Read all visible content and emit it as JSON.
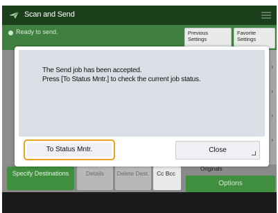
{
  "header": {
    "title": "Scan and Send",
    "icon": "send-arrow-icon",
    "menu_icon": "menu-icon"
  },
  "status": {
    "text": "Ready to send.",
    "previous_settings": "Previous Settings",
    "favorite_settings": "Favorite Settings"
  },
  "background": {
    "specify_destinations": "Specify Destinations",
    "details": "Details",
    "delete_dest": "Delete Dest.",
    "cc_bcc": "Cc Bcc",
    "originals": "Originals",
    "options": "Options"
  },
  "dialog": {
    "message_line1": "The Send job has been accepted.",
    "message_line2": "Press [To Status Mntr.] to check the current job status.",
    "status_button": "To Status Mntr.",
    "close_button": "Close"
  },
  "colors": {
    "title_bar": "#1b3f1b",
    "status_bar": "#3f7f3f",
    "accent_green": "#3f8f3f",
    "focus_orange": "#f0a020",
    "dialog_panel": "#dadee5"
  }
}
